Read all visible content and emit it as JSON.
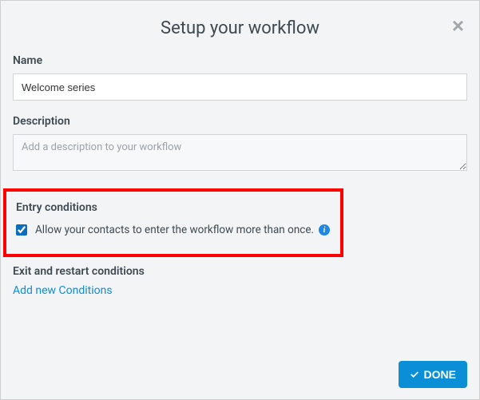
{
  "modal": {
    "title": "Setup your workflow",
    "close_symbol": "×"
  },
  "name": {
    "label": "Name",
    "value": "Welcome series"
  },
  "description": {
    "label": "Description",
    "placeholder": "Add a description to your workflow",
    "value": ""
  },
  "entry": {
    "title": "Entry conditions",
    "checkbox_label": "Allow your contacts to enter the workflow more than once.",
    "info_symbol": "i",
    "checked": true
  },
  "exit": {
    "title": "Exit and restart conditions",
    "add_link": "Add new Conditions"
  },
  "footer": {
    "done_label": "DONE"
  }
}
